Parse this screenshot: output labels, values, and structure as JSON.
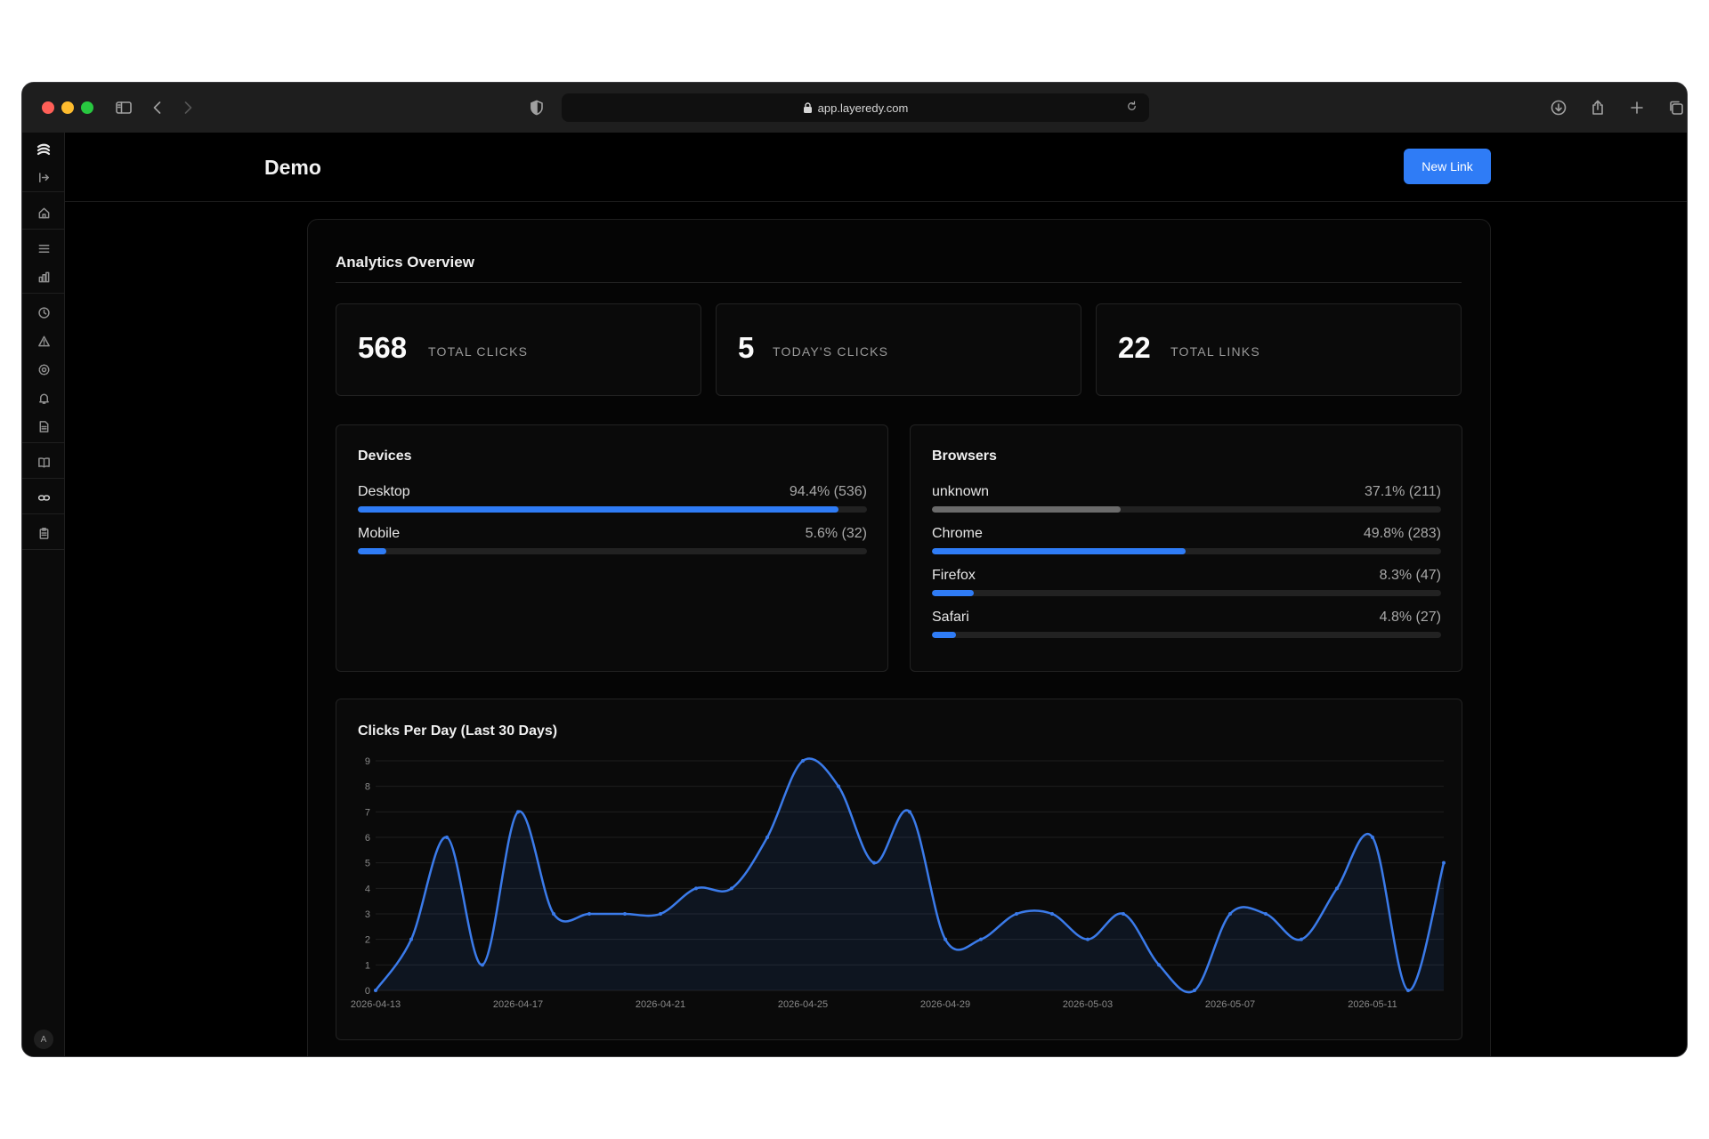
{
  "browser": {
    "url": "app.layeredy.com"
  },
  "sidebar": {
    "items": [
      "logo-icon",
      "collapse-icon",
      "home-icon",
      "list-icon",
      "chart-icon",
      "clock-icon",
      "alert-icon",
      "settings-icon",
      "bell-icon",
      "file-icon",
      "book-icon",
      "link-icon",
      "clipboard-icon"
    ],
    "avatar": "A"
  },
  "header": {
    "title": "Demo",
    "new_link_label": "New Link"
  },
  "overview": {
    "title": "Analytics Overview",
    "stats": [
      {
        "value": "568",
        "label": "TOTAL CLICKS"
      },
      {
        "value": "5",
        "label": "TODAY'S CLICKS"
      },
      {
        "value": "22",
        "label": "TOTAL LINKS"
      }
    ]
  },
  "devices": {
    "title": "Devices",
    "rows": [
      {
        "name": "Desktop",
        "value": "94.4% (536)",
        "percent": 94.4,
        "color": "#2f7cf6"
      },
      {
        "name": "Mobile",
        "value": "5.6% (32)",
        "percent": 5.6,
        "color": "#2f7cf6"
      }
    ]
  },
  "browsers": {
    "title": "Browsers",
    "rows": [
      {
        "name": "unknown",
        "value": "37.1% (211)",
        "percent": 37.1,
        "color": "#6b6b6b"
      },
      {
        "name": "Chrome",
        "value": "49.8% (283)",
        "percent": 49.8,
        "color": "#2f7cf6"
      },
      {
        "name": "Firefox",
        "value": "8.3% (47)",
        "percent": 8.3,
        "color": "#2f7cf6"
      },
      {
        "name": "Safari",
        "value": "4.8% (27)",
        "percent": 4.8,
        "color": "#2f7cf6"
      }
    ]
  },
  "chart_data": {
    "type": "area",
    "title": "Clicks Per Day (Last 30 Days)",
    "xlabel": "",
    "ylabel": "",
    "ylim": [
      0,
      9
    ],
    "yticks": [
      0,
      1,
      2,
      3,
      4,
      5,
      6,
      7,
      8,
      9
    ],
    "grid": true,
    "line_color": "#3b7bea",
    "x": [
      "2026-04-13",
      "2026-04-14",
      "2026-04-15",
      "2026-04-16",
      "2026-04-17",
      "2026-04-18",
      "2026-04-19",
      "2026-04-20",
      "2026-04-21",
      "2026-04-22",
      "2026-04-23",
      "2026-04-24",
      "2026-04-25",
      "2026-04-26",
      "2026-04-27",
      "2026-04-28",
      "2026-04-29",
      "2026-04-30",
      "2026-05-01",
      "2026-05-02",
      "2026-05-03",
      "2026-05-04",
      "2026-05-05",
      "2026-05-06",
      "2026-05-07",
      "2026-05-08",
      "2026-05-09",
      "2026-05-10",
      "2026-05-11",
      "2026-05-12",
      "2026-05-13"
    ],
    "series": [
      {
        "values": [
          0,
          2,
          6,
          1,
          7,
          3,
          3,
          3,
          3,
          4,
          4,
          6,
          9,
          8,
          5,
          7,
          2,
          2,
          3,
          3,
          2,
          3,
          1,
          0,
          3,
          3,
          2,
          4,
          6,
          0,
          5
        ]
      }
    ],
    "xtick_labels": [
      "2026-04-13",
      "2026-04-17",
      "2026-04-21",
      "2026-04-25",
      "2026-04-29",
      "2026-05-03",
      "2026-05-07",
      "2026-05-11"
    ]
  }
}
